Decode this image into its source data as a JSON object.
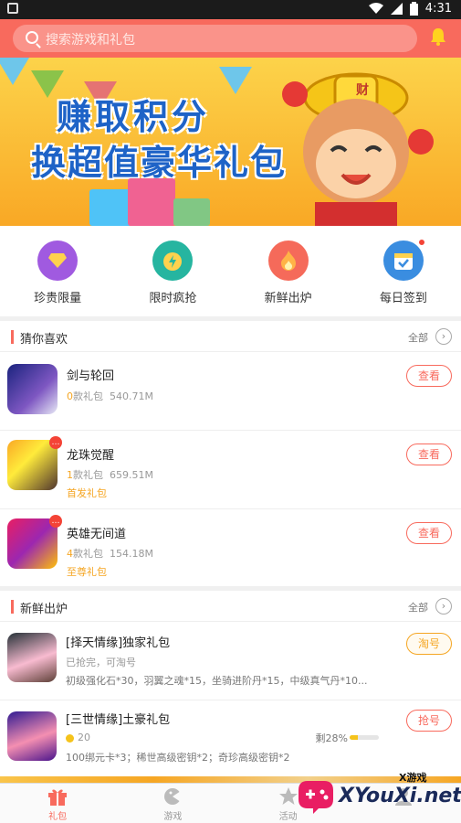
{
  "status_bar": {
    "time": "4:31"
  },
  "search": {
    "placeholder": "搜索游戏和礼包"
  },
  "banner": {
    "line1": "赚取积分",
    "line2": "换超值豪华礼包",
    "seal_char": "财"
  },
  "quick_entries": [
    {
      "label": "珍贵限量",
      "icon": "diamond-icon",
      "color": "#a05ae0"
    },
    {
      "label": "限时疯抢",
      "icon": "timer-icon",
      "color": "#26b5a0"
    },
    {
      "label": "新鲜出炉",
      "icon": "flame-icon",
      "color": "#f56a5a"
    },
    {
      "label": "每日签到",
      "icon": "calendar-check-icon",
      "color": "#3a8de0"
    }
  ],
  "guess": {
    "title": "猜你喜欢",
    "all_label": "全部",
    "items": [
      {
        "name": "剑与轮回",
        "count": "0",
        "count_suffix": "款礼包",
        "size": "540.71M",
        "tag": "",
        "button": "查看"
      },
      {
        "name": "龙珠觉醒",
        "count": "1",
        "count_suffix": "款礼包",
        "size": "659.51M",
        "tag": "首发礼包",
        "button": "查看"
      },
      {
        "name": "英雄无间道",
        "count": "4",
        "count_suffix": "款礼包",
        "size": "154.18M",
        "tag": "至尊礼包",
        "button": "查看"
      }
    ]
  },
  "fresh": {
    "title": "新鲜出炉",
    "all_label": "全部",
    "items": [
      {
        "title": "[择天情缘]独家礼包",
        "status": "已抢完，可淘号",
        "desc": "初级强化石*30，羽翼之魂*15，坐骑进阶丹*15，中级真气丹*10...",
        "button": "淘号"
      },
      {
        "title": "[三世情缘]土豪礼包",
        "coins": "20",
        "remaining": "剩28%",
        "remaining_fraction": 0.28,
        "desc": "100绑元卡*3；稀世高级密钥*2；奇珍高级密钥*2",
        "button": "抢号"
      }
    ]
  },
  "tabs": [
    {
      "label": "礼包",
      "icon": "gift-icon",
      "active": true
    },
    {
      "label": "游戏",
      "icon": "gamepad-icon",
      "active": false
    },
    {
      "label": "活动",
      "icon": "star-icon",
      "active": false
    },
    {
      "label": "",
      "icon": "user-icon",
      "active": false
    }
  ],
  "watermark": {
    "small": "X游戏",
    "text": "XYouXi.net"
  }
}
